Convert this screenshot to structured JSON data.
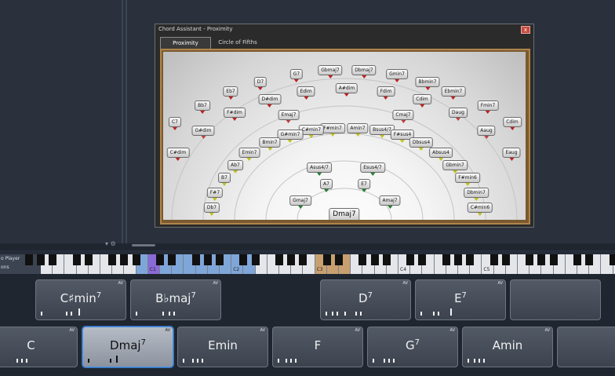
{
  "window": {
    "title": "Chord Assistant - Proximity",
    "close_label": "x"
  },
  "tabs": [
    {
      "label": "Proximity"
    },
    {
      "label": "Circle of Fifths"
    }
  ],
  "chords": [
    {
      "label": "G7",
      "c": "#c02020"
    },
    {
      "label": "Gbmaj7",
      "c": "#c02020"
    },
    {
      "label": "Dbmaj7",
      "c": "#c02020"
    },
    {
      "label": "D7",
      "c": "#c02020"
    },
    {
      "label": "Gmin7",
      "c": "#c02020"
    },
    {
      "label": "Bbmin7",
      "c": "#c02020"
    },
    {
      "label": "Eb7",
      "c": "#c02020"
    },
    {
      "label": "Edim",
      "c": "#c02020"
    },
    {
      "label": "A#dim",
      "c": "#c02020"
    },
    {
      "label": "Fdim",
      "c": "#c02020"
    },
    {
      "label": "Ebmin7",
      "c": "#c02020"
    },
    {
      "label": "D#dim",
      "c": "#c02020"
    },
    {
      "label": "Cdim",
      "c": "#c02020"
    },
    {
      "label": "Bb7",
      "c": "#c02020"
    },
    {
      "label": "Fmin7",
      "c": "#c02020"
    },
    {
      "label": "F#dim",
      "c": "#c02020"
    },
    {
      "label": "Emaj7",
      "c": "#c04040"
    },
    {
      "label": "Cmaj7",
      "c": "#c04040"
    },
    {
      "label": "Daug",
      "c": "#c04040"
    },
    {
      "label": "C7",
      "c": "#c02020"
    },
    {
      "label": "Cdim",
      "c": "#c02020"
    },
    {
      "label": "F#min7",
      "c": "#c0c020"
    },
    {
      "label": "Amin7",
      "c": "#c0c020"
    },
    {
      "label": "C#min7",
      "c": "#c0c020"
    },
    {
      "label": "Bsus4/7",
      "c": "#c0c020"
    },
    {
      "label": "G#dim",
      "c": "#c04040"
    },
    {
      "label": "G#min7",
      "c": "#c0c020"
    },
    {
      "label": "F#sus4",
      "c": "#c0c020"
    },
    {
      "label": "Aaug",
      "c": "#c04040"
    },
    {
      "label": "Bmin7",
      "c": "#c0c020"
    },
    {
      "label": "Dbsus4",
      "c": "#c0c020"
    },
    {
      "label": "C#dim",
      "c": "#c02020"
    },
    {
      "label": "Emin7",
      "c": "#c0c020"
    },
    {
      "label": "Absus4",
      "c": "#c0c020"
    },
    {
      "label": "Eaug",
      "c": "#c02020"
    },
    {
      "label": "Ab7",
      "c": "#c0c020"
    },
    {
      "label": "Gbmin7",
      "c": "#c0c020"
    },
    {
      "label": "Asus4/7",
      "c": "#208030"
    },
    {
      "label": "Esus4/7",
      "c": "#208030"
    },
    {
      "label": "B7",
      "c": "#c0c020"
    },
    {
      "label": "F#min6",
      "c": "#c0c020"
    },
    {
      "label": "A7",
      "c": "#208030"
    },
    {
      "label": "E7",
      "c": "#208030"
    },
    {
      "label": "F#7",
      "c": "#c0c020"
    },
    {
      "label": "Dbmin7",
      "c": "#c0c020"
    },
    {
      "label": "Gmaj7",
      "c": "#208030"
    },
    {
      "label": "Amaj7",
      "c": "#208030"
    },
    {
      "label": "Db7",
      "c": "#c0c020"
    },
    {
      "label": "C#min6",
      "c": "#c0c020"
    },
    {
      "label": "Dmaj7",
      "c": "#4070c0"
    }
  ],
  "keyboard": {
    "left_labels": [
      "o Player",
      "ons"
    ],
    "octave_labels": [
      "C1",
      "C2",
      "C3",
      "C4",
      "C5"
    ],
    "colors": {
      "white": "#e4e6ea",
      "blue": "#7fa6d8",
      "purple": "#8a6ad6",
      "tan": "#c8a070",
      "black": "#111111"
    }
  },
  "pads_row1": [
    {
      "root": "C♯min",
      "ext": "7",
      "av": "AV"
    },
    {
      "root": "B♭maj",
      "ext": "7",
      "av": "AV"
    },
    {
      "root": "D",
      "ext": "7",
      "av": "AV"
    },
    {
      "root": "E",
      "ext": "7",
      "av": "AV"
    },
    {
      "root": "",
      "ext": "",
      "av": ""
    }
  ],
  "pads_row2": [
    {
      "root": "C",
      "ext": "",
      "av": "AV"
    },
    {
      "root": "Dmaj",
      "ext": "7",
      "av": "AV"
    },
    {
      "root": "Emin",
      "ext": "",
      "av": "AV"
    },
    {
      "root": "F",
      "ext": "",
      "av": "AV"
    },
    {
      "root": "G",
      "ext": "7",
      "av": "AV"
    },
    {
      "root": "Amin",
      "ext": "",
      "av": "AV"
    },
    {
      "root": "",
      "ext": "",
      "av": ""
    }
  ]
}
